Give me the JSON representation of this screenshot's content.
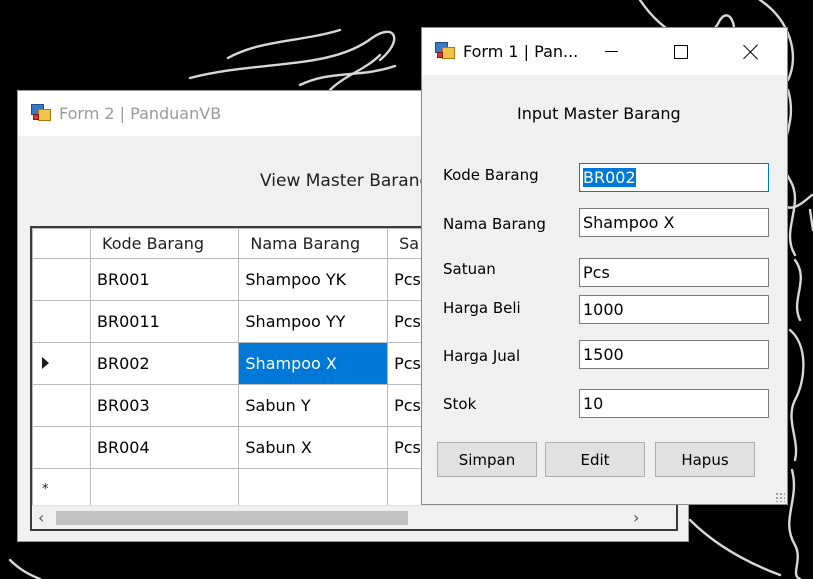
{
  "form2": {
    "title": "Form 2 | PanduanVB",
    "heading": "View Master Barang",
    "grid": {
      "columns": [
        "Kode Barang",
        "Nama Barang",
        "Sa"
      ],
      "rows": [
        {
          "kode": "BR001",
          "nama": "Shampoo YK",
          "satuan": "Pcs"
        },
        {
          "kode": "BR0011",
          "nama": "Shampoo YY",
          "satuan": "Pcs"
        },
        {
          "kode": "BR002",
          "nama": "Shampoo X",
          "satuan": "Pcs"
        },
        {
          "kode": "BR003",
          "nama": "Sabun Y",
          "satuan": "Pcs"
        },
        {
          "kode": "BR004",
          "nama": "Sabun X",
          "satuan": "Pcs"
        }
      ],
      "new_row_marker": "*",
      "scroll_left": "‹",
      "scroll_right": "›"
    }
  },
  "form1": {
    "title": "Form 1 | Pan...",
    "heading": "Input Master Barang",
    "fields": {
      "kode_label": "Kode Barang",
      "kode_value": "BR002",
      "nama_label": "Nama Barang",
      "nama_value": "Shampoo X",
      "satuan_label": "Satuan",
      "satuan_value": "Pcs",
      "beli_label": "Harga Beli",
      "beli_value": "1000",
      "jual_label": "Harga Jual",
      "jual_value": "1500",
      "stok_label": "Stok",
      "stok_value": "10"
    },
    "buttons": {
      "simpan": "Simpan",
      "edit": "Edit",
      "hapus": "Hapus"
    }
  },
  "colors": {
    "selection": "#0078d7",
    "background": "#000000",
    "window": "#f0f0f0"
  }
}
